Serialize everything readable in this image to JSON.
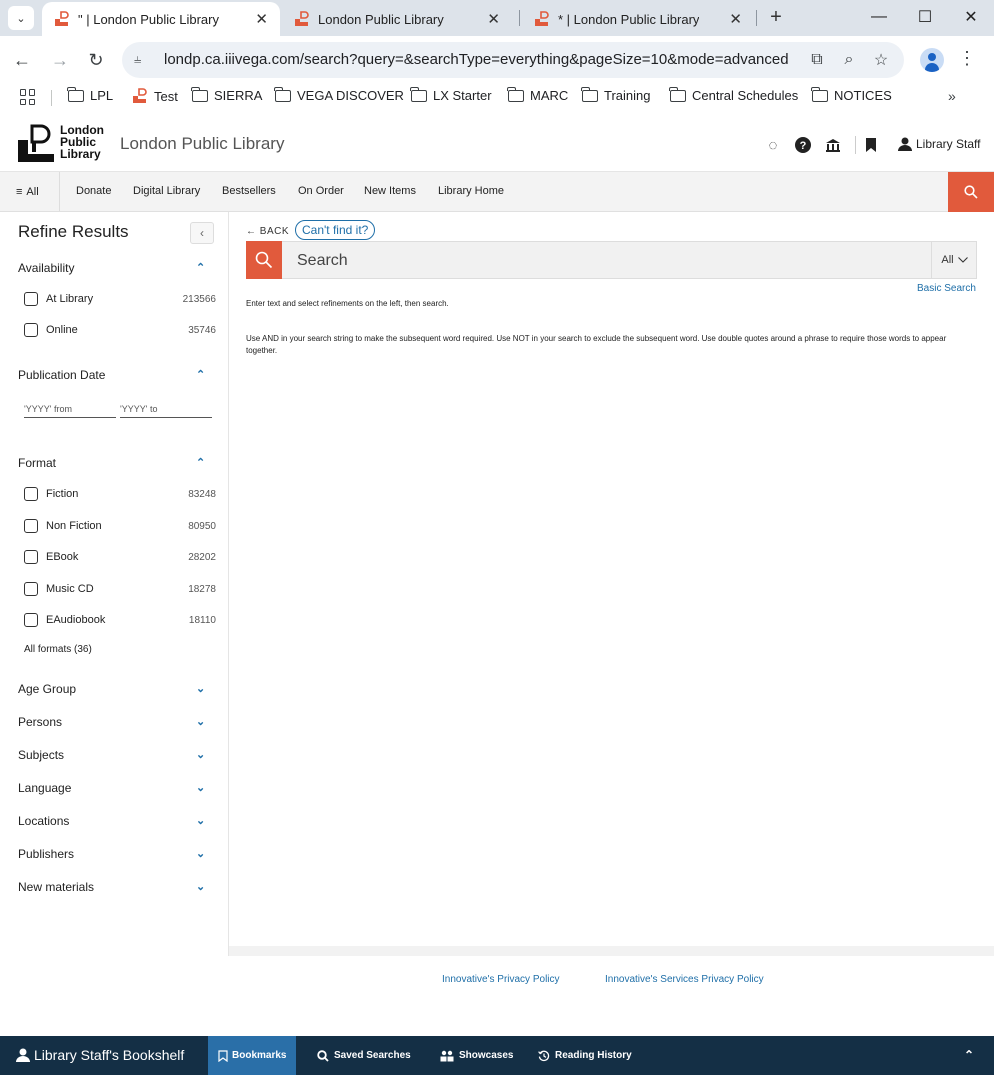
{
  "browser": {
    "tabs": [
      {
        "title": "\" | London Public Library",
        "active": true
      },
      {
        "title": "London Public Library",
        "active": false
      },
      {
        "title": "* | London Public Library",
        "active": false
      }
    ],
    "url_site_icon": "tune-icon",
    "url": "londp.ca.iiivega.com/search?query=&searchType=everything&pageSize=10&mode=advanced",
    "bookmarks": [
      "LPL",
      "Test",
      "SIERRA",
      "VEGA DISCOVER",
      "LX Starter",
      "MARC",
      "Training",
      "Central Schedules",
      "NOTICES"
    ]
  },
  "site": {
    "logo_lines": [
      "London",
      "Public",
      "Library"
    ],
    "title": "London Public Library",
    "user_label": "Library Staff"
  },
  "nav": {
    "all_label": "All",
    "items": [
      "Donate",
      "Digital Library",
      "Bestsellers",
      "On Order",
      "New Items",
      "Library Home"
    ]
  },
  "sidebar": {
    "title": "Refine Results",
    "availability": {
      "heading": "Availability",
      "options": [
        {
          "label": "At Library",
          "count": "213566"
        },
        {
          "label": "Online",
          "count": "35746"
        }
      ]
    },
    "pubdate": {
      "heading": "Publication Date",
      "from_placeholder": "'YYYY' from",
      "to_placeholder": "'YYYY' to"
    },
    "format": {
      "heading": "Format",
      "options": [
        {
          "label": "Fiction",
          "count": "83248"
        },
        {
          "label": "Non Fiction",
          "count": "80950"
        },
        {
          "label": "EBook",
          "count": "28202"
        },
        {
          "label": "Music CD",
          "count": "18278"
        },
        {
          "label": "EAudiobook",
          "count": "18110"
        }
      ],
      "all_link": "All formats (36)"
    },
    "collapsed_facets": [
      "Age Group",
      "Persons",
      "Subjects",
      "Language",
      "Locations",
      "Publishers",
      "New materials"
    ]
  },
  "main": {
    "back_label": "BACK",
    "cant_find": "Can't find it?",
    "search_placeholder": "Search",
    "scope": "All",
    "basic_search": "Basic Search",
    "help1": "Enter text and select refinements on the left, then search.",
    "help2": "Use AND in your search string to make the subsequent word required. Use NOT in your search to exclude the subsequent word. Use double quotes around a phrase to require those words to appear together."
  },
  "footer": {
    "links": [
      "Innovative's Privacy Policy",
      "Innovative's Services Privacy Policy"
    ]
  },
  "bottombar": {
    "title": "Library Staff's Bookshelf",
    "items": [
      {
        "label": "Bookmarks",
        "icon": "bookmark-outline-icon",
        "active": true
      },
      {
        "label": "Saved Searches",
        "icon": "search-icon",
        "active": false
      },
      {
        "label": "Showcases",
        "icon": "showcase-icon",
        "active": false
      },
      {
        "label": "Reading History",
        "icon": "history-icon",
        "active": false
      }
    ]
  },
  "colors": {
    "brand_orange": "#e15a3c",
    "link_blue": "#1f6fa8",
    "bottom_bar": "#142f45",
    "active_tab_blue": "#2a6fa8"
  }
}
